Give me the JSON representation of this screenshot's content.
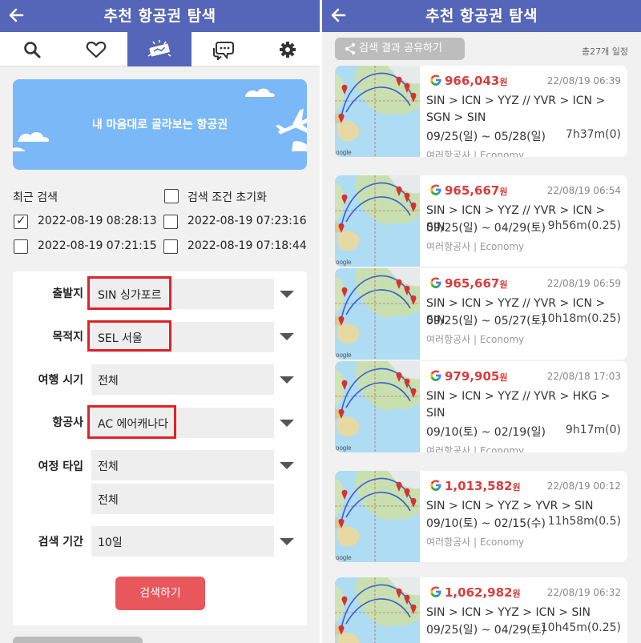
{
  "left": {
    "header": {
      "back_icon": "arrow-left-icon",
      "title": "추천 항공권 탐색"
    },
    "tabs": [
      "search-icon",
      "heart-icon",
      "ticket-icon",
      "chat-icon",
      "gear-icon"
    ],
    "banner": {
      "text": "내 마음대로 골라보는 항공권"
    },
    "recent": {
      "title": "최근 검색",
      "reset_label": "검색 조건 초기화",
      "items": [
        {
          "label": "2022-08-19 08:28:13",
          "checked": true
        },
        {
          "label": "2022-08-19 07:23:16",
          "checked": false
        },
        {
          "label": "2022-08-19 07:21:15",
          "checked": false
        },
        {
          "label": "2022-08-19 07:18:44",
          "checked": false
        }
      ]
    },
    "form": {
      "departure": {
        "label": "출발지",
        "value": "SIN 싱가포르"
      },
      "destination": {
        "label": "목적지",
        "value": "SEL 서울"
      },
      "travel_time": {
        "label": "여행 시기",
        "value": "전체"
      },
      "airline": {
        "label": "항공사",
        "value": "AC 에어캐나다"
      },
      "trip_type": {
        "label": "여정 타입",
        "value": "전체",
        "value2": "전체"
      },
      "search_period": {
        "label": "검색 기간",
        "value": "10일"
      },
      "search_button": "검색하기"
    },
    "highlight_color": "#e0212b"
  },
  "right": {
    "header": {
      "back_icon": "arrow-left-icon",
      "title": "추천 항공권 탐색"
    },
    "share_label": "검색 결과 공유하기",
    "share_icon": "share-icon",
    "total": "총27개 일정",
    "results": [
      {
        "price": "966,043",
        "won": "원",
        "date": "22/08/19 06:39",
        "route": "SIN > ICN > YYZ // YVR > ICN > SGN > SIN",
        "period": "09/25(일) ~ 05/28(일)",
        "duration": "7h37m(0)",
        "airline": "여러항공사 | Economy"
      },
      {
        "price": "965,667",
        "won": "원",
        "date": "22/08/19 06:54",
        "route": "SIN > ICN > YYZ // YVR > ICN > SIN",
        "period": "09/25(일) ~ 04/29(토)",
        "duration": "9h56m(0.25)",
        "airline": "여러항공사 | Economy"
      },
      {
        "price": "965,667",
        "won": "원",
        "date": "22/08/19 06:59",
        "route": "SIN > ICN > YYZ // YVR > ICN > SIN",
        "period": "09/25(일) ~ 05/27(토)",
        "duration": "10h18m(0.25)",
        "airline": "여러항공사 | Economy"
      },
      {
        "price": "979,905",
        "won": "원",
        "date": "22/08/18 17:03",
        "route": "SIN > ICN > YYZ // YVR > HKG > SIN",
        "period": "09/10(토) ~ 02/19(일)",
        "duration": "9h17m(0)",
        "airline": "여러항공사 | Economy"
      },
      {
        "price": "1,013,582",
        "won": "원",
        "date": "22/08/19 00:12",
        "route": "SIN > ICN > YYZ > YVR > SIN",
        "period": "09/10(토) ~ 02/15(수)",
        "duration": "11h58m(0.5)",
        "airline": "여러항공사 | Economy"
      },
      {
        "price": "1,062,982",
        "won": "원",
        "date": "22/08/19 06:32",
        "route": "SIN > ICN > YYZ > ICN > SIN",
        "period": "09/25(일) ~ 04/29(토)",
        "duration": "10h45m(0.25)",
        "airline": ""
      }
    ],
    "map_label": "Google"
  },
  "colors": {
    "header": "#5565b7",
    "price": "#d93c3c",
    "google": "#4285f4",
    "button": "#e8575c"
  }
}
